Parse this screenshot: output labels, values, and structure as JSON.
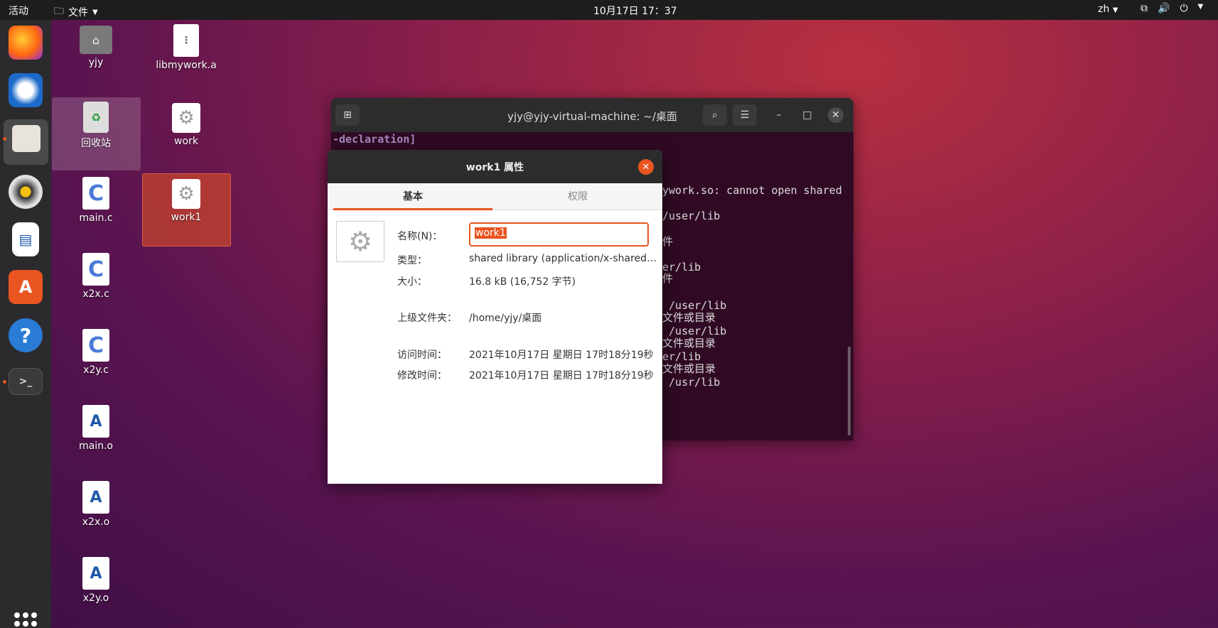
{
  "topbar": {
    "activities": "活动",
    "files_menu": "文件",
    "clock": "10月17日  17：37",
    "lang": "zh"
  },
  "desktop": {
    "icons": [
      {
        "label": "yjy"
      },
      {
        "label": "libmywork.a"
      },
      {
        "label": "回收站"
      },
      {
        "label": "work"
      },
      {
        "label": "main.c"
      },
      {
        "label": "work1"
      },
      {
        "label": "x2x.c"
      },
      {
        "label": "x2y.c"
      },
      {
        "label": "main.o"
      },
      {
        "label": "x2x.o"
      },
      {
        "label": "x2y.o"
      }
    ]
  },
  "terminal": {
    "title": "yjy@yjy-virtual-machine: ~/桌面",
    "lines": [
      {
        "text": "-declaration]",
        "kind": "decl"
      },
      {
        "text": "ywork.so: cannot open shared"
      },
      {
        "text": "/user/lib"
      },
      {
        "text": "件"
      },
      {
        "text": "er/lib"
      },
      {
        "text": "件"
      },
      {
        "text": " /user/lib"
      },
      {
        "text": "文件或目录"
      },
      {
        "text": " /user/lib"
      },
      {
        "text": "文件或目录"
      },
      {
        "text": "er/lib"
      },
      {
        "text": "文件或目录"
      },
      {
        "text": " /usr/lib"
      }
    ]
  },
  "dialog": {
    "title": "work1 属性",
    "tabs": [
      "基本",
      "权限"
    ],
    "name_label": "名称(N)：",
    "name_value": "work1",
    "type_label": "类型：",
    "type_value": "shared library (application/x-sharedlib)",
    "size_label": "大小：",
    "size_value": "16.8 kB (16,752 字节)",
    "parent_label": "上级文件夹：",
    "parent_value": "/home/yjy/桌面",
    "access_label": "访问时间：",
    "access_value": "2021年10月17日 星期日 17时18分19秒",
    "modify_label": "修改时间：",
    "modify_value": "2021年10月17日 星期日 17时18分19秒"
  }
}
